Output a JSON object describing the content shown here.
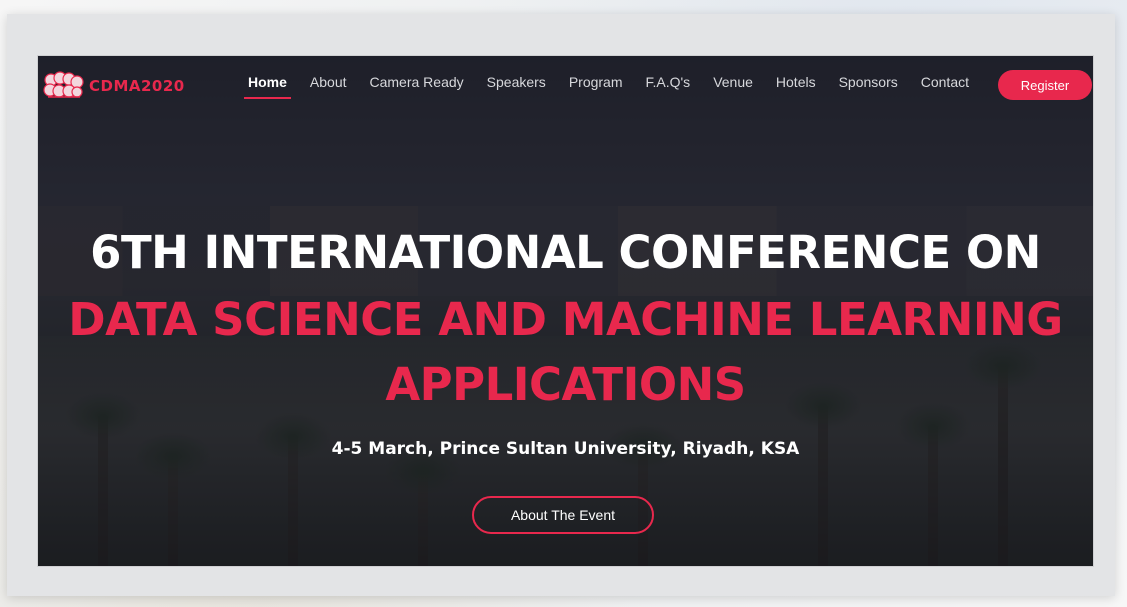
{
  "brand": {
    "name": "CDMA2020",
    "color": "#e8284d"
  },
  "nav": {
    "items": [
      {
        "label": "Home",
        "active": true
      },
      {
        "label": "About"
      },
      {
        "label": "Camera Ready"
      },
      {
        "label": "Speakers"
      },
      {
        "label": "Program"
      },
      {
        "label": "F.A.Q's"
      },
      {
        "label": "Venue"
      },
      {
        "label": "Hotels"
      },
      {
        "label": "Sponsors"
      },
      {
        "label": "Contact"
      }
    ],
    "register_label": "Register"
  },
  "hero": {
    "line1": "6TH INTERNATIONAL CONFERENCE ON",
    "line2": "DATA SCIENCE AND MACHINE LEARNING",
    "line3": "APPLICATIONS",
    "subtitle": "4-5 March, Prince Sultan University, Riyadh, KSA",
    "cta_label": "About The Event"
  },
  "icons": {
    "logo": "brain-icon"
  }
}
